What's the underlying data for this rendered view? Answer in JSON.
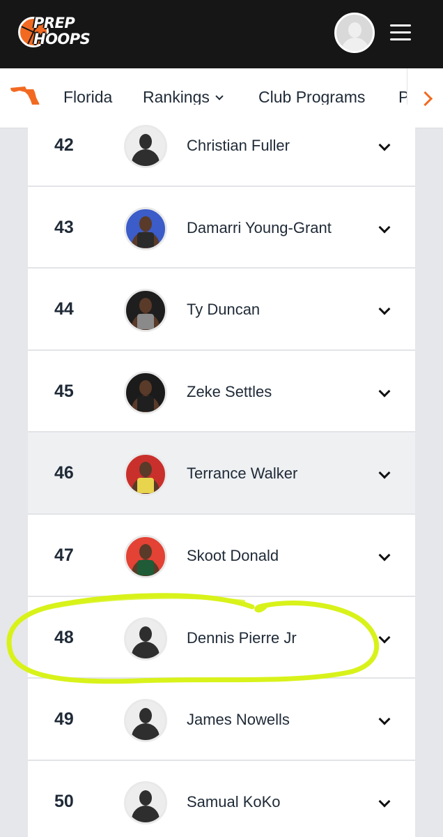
{
  "header": {
    "logo": {
      "line1": "PREP",
      "line2": "HOOPS"
    },
    "profile_icon": "user-avatar-icon",
    "menu_icon": "hamburger-menu-icon",
    "background": "#161616"
  },
  "nav": {
    "state_icon": "florida-state-icon",
    "items": [
      {
        "label": "Florida"
      },
      {
        "label": "Rankings",
        "has_dropdown": true
      },
      {
        "label": "Club Programs"
      },
      {
        "label": "P"
      }
    ],
    "scroll_icon": "chevron-right-icon",
    "accent": "#f26a21"
  },
  "rankings": [
    {
      "rank": "42",
      "name": "Christian Fuller",
      "photo": "placeholder"
    },
    {
      "rank": "43",
      "name": "Damarri Young-Grant",
      "photo": "player"
    },
    {
      "rank": "44",
      "name": "Ty Duncan",
      "photo": "player"
    },
    {
      "rank": "45",
      "name": "Zeke Settles",
      "photo": "player"
    },
    {
      "rank": "46",
      "name": "Terrance Walker",
      "photo": "player",
      "highlighted": true
    },
    {
      "rank": "47",
      "name": "Skoot Donald",
      "photo": "player"
    },
    {
      "rank": "48",
      "name": "Dennis Pierre Jr",
      "photo": "placeholder",
      "circled": true
    },
    {
      "rank": "49",
      "name": "James Nowells",
      "photo": "placeholder"
    },
    {
      "rank": "50",
      "name": "Samual KoKo",
      "photo": "placeholder"
    }
  ],
  "annotation": {
    "color": "#d8f21a"
  }
}
